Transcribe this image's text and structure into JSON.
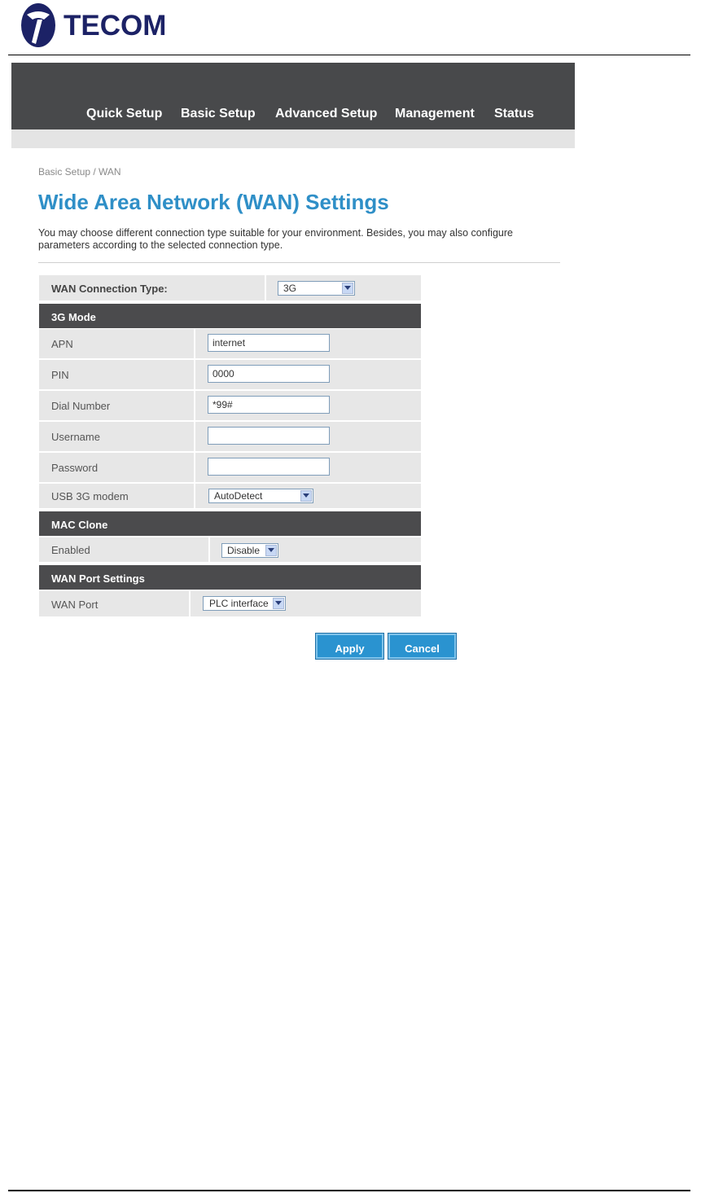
{
  "brand": {
    "logo_text": "TECOM",
    "logo_icon": "tecom-logo-icon"
  },
  "nav": {
    "items": [
      {
        "label": "Quick Setup"
      },
      {
        "label": "Basic Setup"
      },
      {
        "label": "Advanced Setup"
      },
      {
        "label": "Management"
      },
      {
        "label": "Status"
      }
    ]
  },
  "breadcrumb": "Basic Setup / WAN",
  "page_title": "Wide Area Network (WAN) Settings",
  "intro": "You may choose different connection type suitable for your environment. Besides, you may also configure parameters according to the selected connection type.",
  "wan_type": {
    "label": "WAN Connection Type:",
    "value": "3G"
  },
  "sections": {
    "mode": {
      "title": "3G Mode",
      "apn": {
        "label": "APN",
        "value": "internet"
      },
      "pin": {
        "label": "PIN",
        "value": "0000"
      },
      "dial": {
        "label": "Dial Number",
        "value": "*99#"
      },
      "username": {
        "label": "Username",
        "value": ""
      },
      "password": {
        "label": "Password",
        "value": ""
      },
      "usb_modem": {
        "label": "USB 3G modem",
        "value": "AutoDetect"
      }
    },
    "mac_clone": {
      "title": "MAC Clone",
      "enabled": {
        "label": "Enabled",
        "value": "Disable"
      }
    },
    "wan_port": {
      "title": "WAN Port Settings",
      "port": {
        "label": "WAN Port",
        "value": "PLC interface"
      }
    }
  },
  "buttons": {
    "apply": "Apply",
    "cancel": "Cancel"
  },
  "colors": {
    "nav_bg": "#48494b",
    "title": "#2f8fc7",
    "section_bg": "#4b4b4d",
    "row_bg": "#e7e7e7",
    "button": "#2a93d0"
  }
}
